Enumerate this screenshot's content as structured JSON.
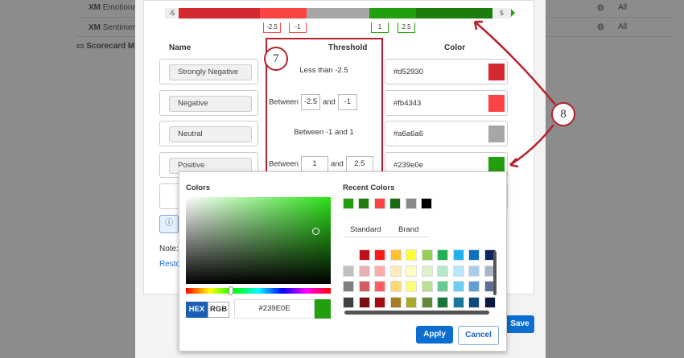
{
  "background": {
    "rows": [
      {
        "prefix": "XM",
        "label": "Emotional",
        "scope": "All"
      },
      {
        "prefix": "XM",
        "label": "Sentiment",
        "scope": "All"
      }
    ],
    "folder": "Scorecard M"
  },
  "slider": {
    "min": "-5",
    "max": "5",
    "markers": [
      "-2.5",
      "-1",
      "1",
      "2.5"
    ]
  },
  "table": {
    "headers": {
      "name": "Name",
      "threshold": "Threshold",
      "color": "Color"
    },
    "rows": [
      {
        "name": "Strongly Negative",
        "threshold_text": "Less than -2.5",
        "hex": "#d52930",
        "color": "#d52930"
      },
      {
        "name": "Negative",
        "between": "Between",
        "from": "-2.5",
        "and": "and",
        "to": "-1",
        "hex": "#fb4343",
        "color": "#fb4343"
      },
      {
        "name": "Neutral",
        "threshold_text": "Between -1 and 1",
        "hex": "#a6a6a6",
        "color": "#a6a6a6"
      },
      {
        "name": "Positive",
        "between": "Between",
        "from": "1",
        "and": "and",
        "to": "2.5",
        "hex": "#239e0e",
        "color": "#239e0e"
      }
    ]
  },
  "note": "Note:",
  "restore": "Resto",
  "save": "Save",
  "annotations": {
    "step7": "7",
    "step8": "8"
  },
  "picker": {
    "colors_label": "Colors",
    "recent_label": "Recent Colors",
    "recent": [
      "#239e0e",
      "#1e7e0c",
      "#fb4343",
      "#1a6a10",
      "#8a8a8a",
      "#000000"
    ],
    "tabs": [
      "Standard",
      "Brand"
    ],
    "mode_hex": "HEX",
    "mode_rgb": "RGB",
    "hex_value": "#239E0E",
    "current": "#239e0e",
    "grid": [
      [
        "",
        "#c0111a",
        "#ff1a1a",
        "#ffc02e",
        "#ffff33",
        "#93cf55",
        "#1faf55",
        "#22b1ef",
        "#0f70c0",
        "#0f2460"
      ],
      [
        "#bfbfbf",
        "#e8b0b4",
        "#ffabab",
        "#ffeab8",
        "#ffffbe",
        "#def0cc",
        "#b5e6c9",
        "#b6e6fa",
        "#a9cdea",
        "#a9b5c9"
      ],
      [
        "#7f7f7f",
        "#d35b63",
        "#ff5c63",
        "#ffd873",
        "#ffff77",
        "#badf90",
        "#68cc92",
        "#6ccef5",
        "#5e9ed5",
        "#5c6d96"
      ],
      [
        "#404040",
        "#7c0c12",
        "#a30c12",
        "#a57c20",
        "#a8a824",
        "#5e8a37",
        "#17763a",
        "#167a9e",
        "#0b497e",
        "#0b1a40"
      ]
    ],
    "apply": "Apply",
    "cancel": "Cancel"
  }
}
